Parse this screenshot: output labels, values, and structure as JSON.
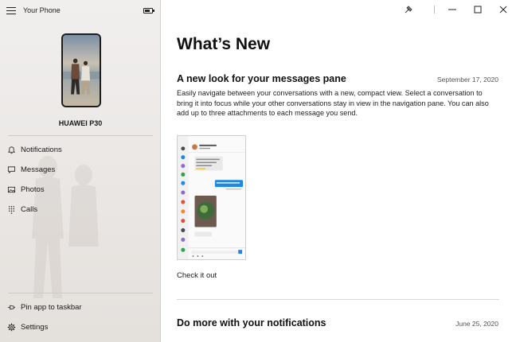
{
  "app": {
    "title": "Your Phone",
    "battery_level": 0.7
  },
  "device": {
    "name": "HUAWEI P30"
  },
  "sidebar": {
    "nav": [
      {
        "id": "notifications",
        "label": "Notifications",
        "icon": "bell-icon"
      },
      {
        "id": "messages",
        "label": "Messages",
        "icon": "chat-bubble-icon"
      },
      {
        "id": "photos",
        "label": "Photos",
        "icon": "image-icon"
      },
      {
        "id": "calls",
        "label": "Calls",
        "icon": "dialpad-icon"
      }
    ],
    "footer": [
      {
        "id": "pin",
        "label": "Pin app to taskbar",
        "icon": "pin-icon"
      },
      {
        "id": "settings",
        "label": "Settings",
        "icon": "gear-icon"
      }
    ]
  },
  "window": {
    "buttons": [
      "pin-window-icon",
      "minimize-icon",
      "maximize-icon",
      "close-icon"
    ]
  },
  "main": {
    "page_title": "What’s New",
    "articles": [
      {
        "title": "A new look for your messages pane",
        "date": "September 17, 2020",
        "body": "Easily navigate between your conversations with a new, compact view. Select a conversation to bring it into focus while your other conversations stay in view in the navigation pane. You can also add up to three attachments to each message you send.",
        "link": "Check it out"
      },
      {
        "title": "Do more with your notifications",
        "date": "June 25, 2020"
      }
    ]
  },
  "colors": {
    "accent": "#0078d7",
    "sidebar_bg": "#ece9e7",
    "text": "#1a1a1a"
  }
}
